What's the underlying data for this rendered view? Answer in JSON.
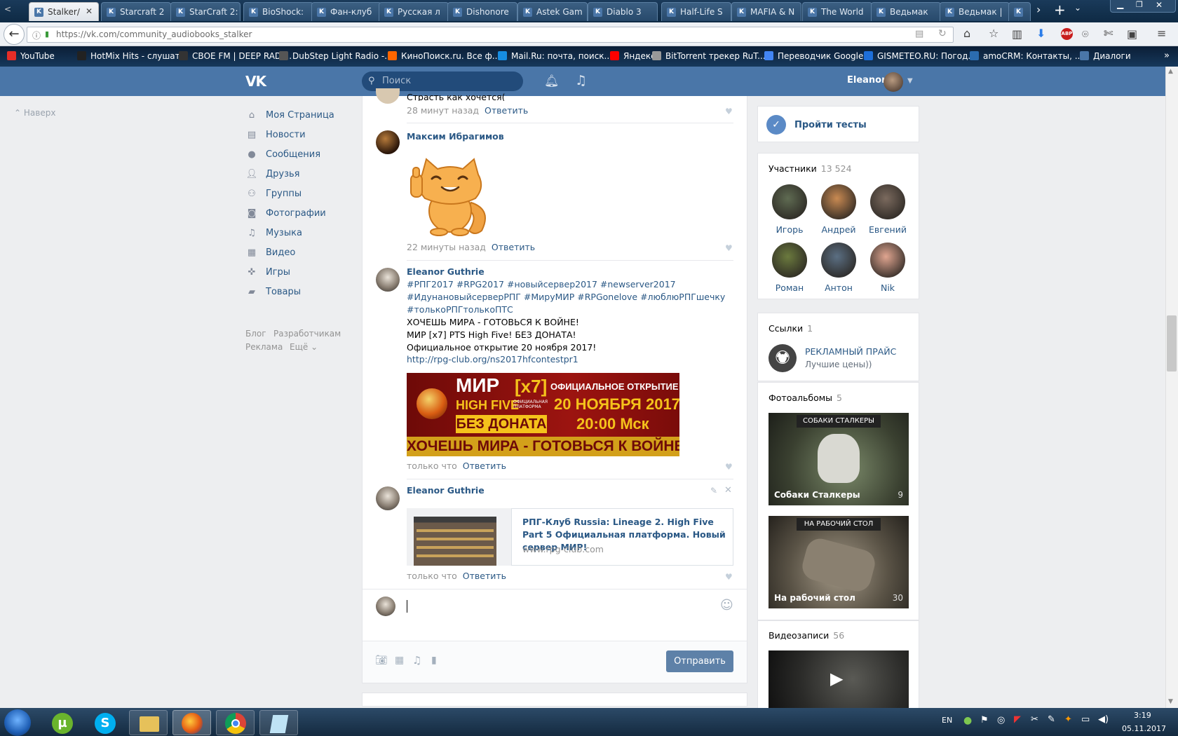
{
  "browser": {
    "tabs": [
      {
        "label": "Stalker/"
      },
      {
        "label": "Starcraft 2"
      },
      {
        "label": "StarCraft 2:"
      },
      {
        "label": "BioShock:"
      },
      {
        "label": "Фан-клуб"
      },
      {
        "label": "Русская л"
      },
      {
        "label": "Dishonore"
      },
      {
        "label": "Astek Gam"
      },
      {
        "label": "Diablo 3"
      },
      {
        "label": "Half-Life S"
      },
      {
        "label": "MAFIA & N"
      },
      {
        "label": "The World"
      },
      {
        "label": "Ведьмак"
      },
      {
        "label": "Ведьмак |"
      }
    ],
    "url": "https://vk.com/community_audiobooks_stalker",
    "bookmarks": [
      {
        "label": "YouTube",
        "color": "#e52d27"
      },
      {
        "label": "HotMix Hits - слушат...",
        "color": "#222"
      },
      {
        "label": "СВОЕ FM | DEEP RADI...",
        "color": "#333"
      },
      {
        "label": "DubStep Light Radio -...",
        "color": "#555"
      },
      {
        "label": "КиноПоиск.ru. Все ф...",
        "color": "#f60"
      },
      {
        "label": "Mail.Ru: почта, поиск...",
        "color": "#168de2"
      },
      {
        "label": "Яндекс",
        "color": "#f00"
      },
      {
        "label": "BitTorrent трекер RuT...",
        "color": "#999"
      },
      {
        "label": "Переводчик Google",
        "color": "#4285f4"
      },
      {
        "label": "GISMETEO.RU: Погод...",
        "color": "#1e6fd9"
      },
      {
        "label": "amoCRM: Контакты, ...",
        "color": "#2b6cb0"
      },
      {
        "label": "Диалоги",
        "color": "#4a76a8"
      }
    ]
  },
  "vk": {
    "search_placeholder": "Поиск",
    "user_name": "Eleanor",
    "up_label": "Наверх",
    "nav": [
      {
        "label": "Моя Страница",
        "icon": "home-icon"
      },
      {
        "label": "Новости",
        "icon": "news-icon"
      },
      {
        "label": "Сообщения",
        "icon": "messages-icon"
      },
      {
        "label": "Друзья",
        "icon": "friends-icon"
      },
      {
        "label": "Группы",
        "icon": "groups-icon"
      },
      {
        "label": "Фотографии",
        "icon": "camera-icon"
      },
      {
        "label": "Музыка",
        "icon": "music-icon"
      },
      {
        "label": "Видео",
        "icon": "video-icon"
      },
      {
        "label": "Игры",
        "icon": "gamepad-icon"
      },
      {
        "label": "Товары",
        "icon": "bag-icon"
      }
    ],
    "footer": {
      "blog": "Блог",
      "dev": "Разработчикам",
      "ads": "Реклама",
      "more": "Ещё"
    }
  },
  "feed": {
    "c0": {
      "text": "Страсть как хочется(",
      "time": "28 минут назад",
      "reply": "Ответить"
    },
    "c1": {
      "author": "Максим Ибрагимов",
      "time": "22 минуты назад",
      "reply": "Ответить"
    },
    "c2": {
      "author": "Eleanor Guthrie",
      "tags1": "#РПГ2017 #RPG2017 #новыйсервер2017 #newserver2017",
      "tags2": "#ИдунановыйсерверРПГ #МируМИР #RPGonelove #люблюРПГшечку",
      "tags3": "#толькоРПГтолькоПТС",
      "line1": "ХОЧЕШЬ МИРА - ГОТОВЬСЯ К ВОЙНЕ!",
      "line2": "МИР [x7] PTS High Five! БЕЗ ДОНАТА!",
      "line3": "Официальное открытие 20 ноября 2017!",
      "link": "http://rpg-club.org/ns2017hfcontestpr1",
      "banner": {
        "t1": "МИР",
        "t2": "[x7]",
        "t3": "HIGH FIVE",
        "t4": "ОФИЦИАЛЬНАЯ ПЛАТФОРМА",
        "t5": "БЕЗ ДОНАТА",
        "t6": "ОФИЦИАЛЬНОЕ ОТКРЫТИЕ",
        "t7": "20 НОЯБРЯ 2017",
        "t8": "20:00 Мск",
        "t9": "ХОЧЕШЬ МИРА - ГОТОВЬСЯ К ВОЙНЕ"
      },
      "time": "только что",
      "reply": "Ответить"
    },
    "c3": {
      "author": "Eleanor Guthrie",
      "link_title": "РПГ-Клуб Russia: Lineage 2. High Five Part 5 Официальная платформа. Новый сервер МИР!",
      "link_domain": "www.rpg-club.com",
      "time": "только что",
      "reply": "Ответить"
    },
    "send": "Отправить"
  },
  "right": {
    "tests": "Пройти тесты",
    "members": {
      "title": "Участники",
      "count": "13 524",
      "list": [
        {
          "name": "Игорь",
          "color": "#5f6b52"
        },
        {
          "name": "Андрей",
          "color": "#c98a52"
        },
        {
          "name": "Евгений",
          "color": "#7b6a5e"
        },
        {
          "name": "Роман",
          "color": "#6b7a3e"
        },
        {
          "name": "Антон",
          "color": "#5b6f83"
        },
        {
          "name": "Nik",
          "color": "#e0a590"
        }
      ]
    },
    "links": {
      "title": "Ссылки",
      "count": "1",
      "name": "РЕКЛАМНЫЙ ПРАЙС",
      "desc": "Лучшие цены))"
    },
    "albums": {
      "title": "Фотоальбомы",
      "count": "5",
      "list": [
        {
          "name": "Собаки Сталкеры",
          "count": "9",
          "heading": "СОБАКИ СТАЛКЕРЫ"
        },
        {
          "name": "На рабочий стол",
          "count": "30",
          "heading": "НА РАБОЧИЙ СТОЛ"
        }
      ]
    },
    "videos": {
      "title": "Видеозаписи",
      "count": "56"
    }
  },
  "taskbar": {
    "lang": "EN",
    "time": "3:19",
    "date": "05.11.2017"
  }
}
